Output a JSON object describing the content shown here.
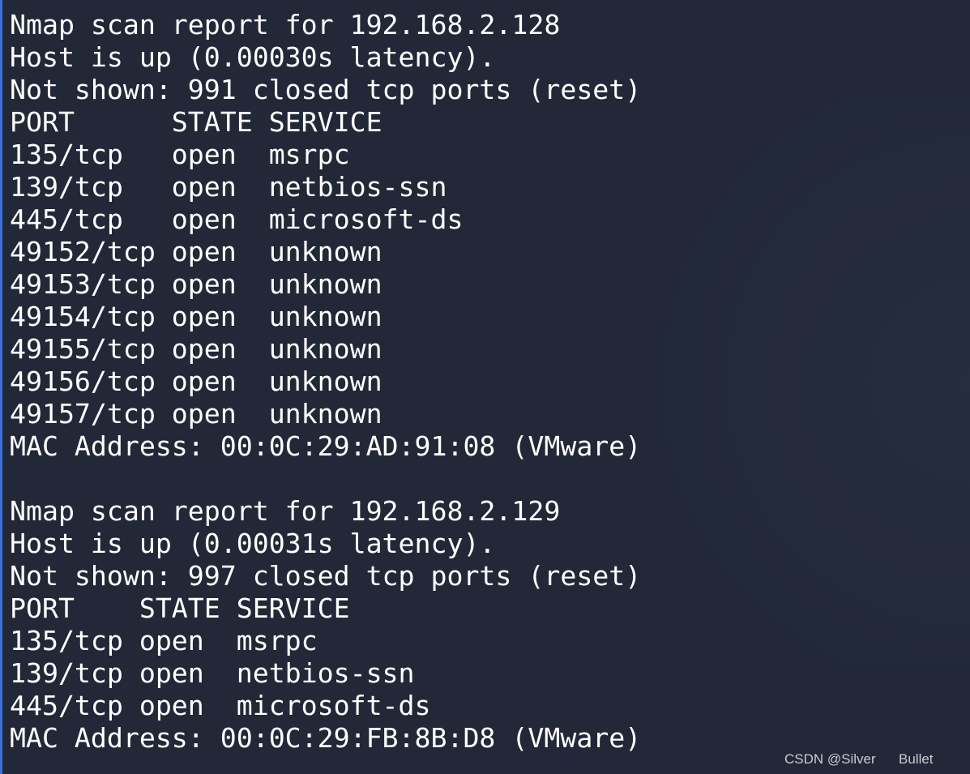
{
  "terminal": {
    "lines": [
      "Nmap scan report for 192.168.2.128",
      "Host is up (0.00030s latency).",
      "Not shown: 991 closed tcp ports (reset)",
      "PORT      STATE SERVICE",
      "135/tcp   open  msrpc",
      "139/tcp   open  netbios-ssn",
      "445/tcp   open  microsoft-ds",
      "49152/tcp open  unknown",
      "49153/tcp open  unknown",
      "49154/tcp open  unknown",
      "49155/tcp open  unknown",
      "49156/tcp open  unknown",
      "49157/tcp open  unknown",
      "MAC Address: 00:0C:29:AD:91:08 (VMware)",
      "",
      "Nmap scan report for 192.168.2.129",
      "Host is up (0.00031s latency).",
      "Not shown: 997 closed tcp ports (reset)",
      "PORT    STATE SERVICE",
      "135/tcp open  msrpc",
      "139/tcp open  netbios-ssn",
      "445/tcp open  microsoft-ds",
      "MAC Address: 00:0C:29:FB:8B:D8 (VMware)"
    ]
  },
  "watermark": "CSDN @Silver      Bullet",
  "colors": {
    "background": "#222837",
    "text": "#ffffff",
    "accent": "#3b6fd6"
  }
}
